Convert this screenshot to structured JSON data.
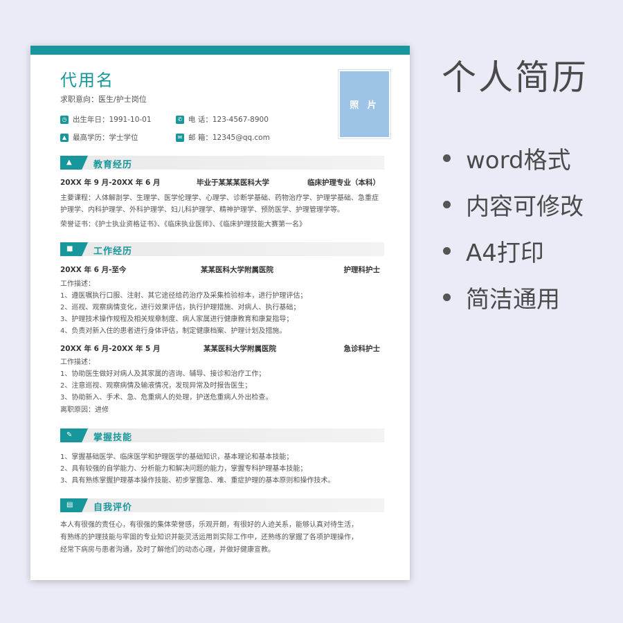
{
  "resume": {
    "name": "代用名",
    "intent": "求职意向：医生/护士岗位",
    "photo": "照 片",
    "info": {
      "birth": "出生年日：1991-10-01",
      "phone": "电 话：123-4567-8900",
      "degree": "最高学历：学士学位",
      "email": "邮 箱：12345@qq.com"
    },
    "education": {
      "title": "教育经历",
      "date": "20XX 年 9 月-20XX 年 6 月",
      "school": "毕业于某某某医科大学",
      "major": "临床护理专业（本科）",
      "courses_1": "主要课程：人体解剖学、生理学、医学伦理学、心理学、诊断学基础、药物治疗学、护理学基础、急重症",
      "courses_2": "护理学、内科护理学、外科护理学、妇儿科护理学、精神护理学、预防医学、护理管理学等。",
      "honors": "荣誉证书：《护士执业资格证书》、《临床执业医师》、《临床护理技能大赛第一名》"
    },
    "work": {
      "title": "工作经历",
      "job1": {
        "date": "20XX 年 6 月-至今",
        "org": "某某医科大学附属医院",
        "role": "护理科护士",
        "label": "工作描述：",
        "items": [
          "1、遵医嘱执行口服、注射、其它途径给药治疗及采集检验标本，进行护理评估；",
          "2、巡视、观察病情变化，进行效果评估，执行护理措施、对病人、执行基础；",
          "3、护理技术操作规程及相关规章制度、病人家属进行健康教育和康复指导；",
          "4、负责对新入住的患者进行身体评估，制定健康档案、护理计划及措施。"
        ]
      },
      "job2": {
        "date": "20XX 年 6 月-20XX 年 5 月",
        "org": "某某医科大学附属医院",
        "role": "急诊科护士",
        "label": "工作描述：",
        "items": [
          "1、协助医生做好对病人及其家属的咨询、辅导、接诊和治疗工作；",
          "2、注意巡视、观察病情及输液情况，发现异常及时报告医生；",
          "3、协助新入、手术、急、危重病人的处理，护送危重病人外出检查。"
        ],
        "leave": "离职原因：进修"
      }
    },
    "skills": {
      "title": "掌握技能",
      "items": [
        "1、掌握基础医学、临床医学和护理医学的基础知识，基本理论和基本技能；",
        "2、具有较强的自学能力、分析能力和解决问题的能力，掌握专科护理基本技能；",
        "3、具有熟练掌握护理基本操作技能、初步掌握急、难、重症护理的基本原则和操作技术。"
      ]
    },
    "self": {
      "title": "自我评价",
      "lines": [
        "本人有很强的责任心，有很强的集体荣誉感，乐观开朗，有很好的人迹关系，能够认真对待生活，",
        "有熟练的护理技能与牢固的专业知识并能灵活运用到实际工作中，还熟练的掌握了各项护理操作，",
        "经常下病房与患者沟通，及时了解他们的动态心理，并做好健康宣教。"
      ]
    }
  },
  "promo": {
    "title": "个人简历",
    "bullets": [
      "word格式",
      "内容可修改",
      "A4打印",
      "简洁通用"
    ]
  },
  "colors": {
    "accent": "#17979b",
    "photo": "#9dc3e6",
    "background": "#ebebf7"
  },
  "icons": [
    "calendar-icon",
    "phone-icon",
    "graduation-cap-icon",
    "mail-icon",
    "briefcase-icon",
    "edit-icon",
    "book-icon"
  ]
}
